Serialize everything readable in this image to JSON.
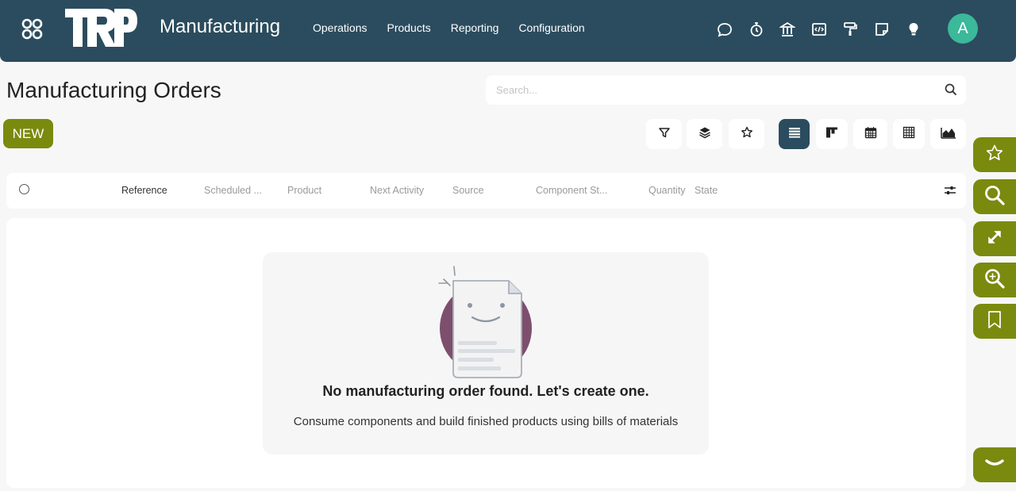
{
  "navbar": {
    "brand_logo_text": "TRP",
    "app_title": "Manufacturing",
    "menu": [
      "Operations",
      "Products",
      "Reporting",
      "Configuration"
    ],
    "system_icons": [
      "chat-icon",
      "stopwatch-icon",
      "bank-icon",
      "code-icon",
      "paint-roller-icon",
      "note-icon",
      "lightbulb-icon"
    ],
    "avatar_letter": "A",
    "avatar_color": "#3cb89a",
    "background_color": "#2b4c5e"
  },
  "control_panel": {
    "page_title": "Manufacturing Orders",
    "search_placeholder": "Search...",
    "new_button_label": "NEW",
    "accent_color": "#7a8a0e",
    "filter_icons": [
      "filter-icon",
      "layers-icon",
      "star-icon"
    ],
    "view_switcher": [
      "list-view-icon",
      "kanban-view-icon",
      "calendar-view-icon",
      "pivot-view-icon",
      "graph-view-icon"
    ],
    "active_view": "list-view-icon"
  },
  "list": {
    "columns": [
      "Reference",
      "Scheduled ...",
      "Product",
      "Next Activity",
      "Source",
      "Component St...",
      "Quantity",
      "State"
    ]
  },
  "empty_state": {
    "title": "No manufacturing order found. Let's create one.",
    "text": "Consume components and build finished products using bills of materials"
  },
  "side_toolbar": [
    "star-icon",
    "search-icon",
    "expand-icon",
    "zoom-in-icon",
    "bookmark-icon",
    "chevron-down-icon"
  ]
}
